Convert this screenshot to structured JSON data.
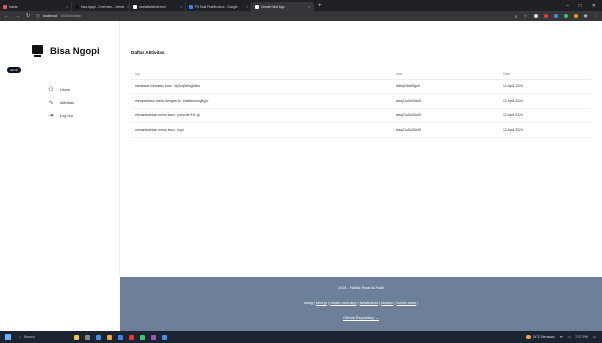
{
  "browser": {
    "tabs": [
      {
        "label": "Inside",
        "color": "#e85a4f",
        "active": false
      },
      {
        "label": "bisa-ngopi - Overview – Vercel",
        "color": "#111111",
        "active": false
      },
      {
        "label": "rizaladlafi/next-test",
        "color": "#ffffff",
        "active": false
      },
      {
        "label": "P3 Soal Praktik.docx - Google",
        "color": "#3b82f6",
        "active": false
      },
      {
        "label": "Create Next App",
        "color": "#ffffff",
        "active": true
      }
    ],
    "new_tab": "+",
    "url_host": "localhost",
    "url_path": ":3000/activity"
  },
  "sidebar": {
    "brand": "Bisa Ngopi",
    "role": "admin",
    "items": [
      {
        "label": "Users",
        "icon": "user-icon",
        "glyph": "⚇"
      },
      {
        "label": "Aktivitas",
        "icon": "activity-icon",
        "glyph": "∿"
      },
      {
        "label": "Log out",
        "icon": "logout-icon",
        "glyph": "⇥"
      }
    ]
  },
  "main": {
    "title": "Daftar Aktivitas",
    "columns": [
      "log",
      "user",
      "Date"
    ],
    "rows": [
      {
        "log": "membuat menuaku baru : idj3oq0eksg0abc",
        "user": "f6kbyf18a03go0",
        "date": "12 April 2024"
      },
      {
        "log": "memperbarui menu dengan id : tlrabbocmuyihjyv",
        "user": "tzeq21u5u00c05",
        "date": "12 April 2024"
      },
      {
        "log": "menambahkan menu baru : porsche 911 gt",
        "user": "tzeq21u5u00c05",
        "date": "12 April 2024"
      },
      {
        "log": "menambahkan menu baru : kopi",
        "user": "tzeq21u5u00c05",
        "date": "12 April 2024"
      }
    ]
  },
  "footer": {
    "credit": "2024 - Hafidz Rizal Al-Fadli",
    "using_prefix": "using |",
    "tech": [
      "next.js",
      "create-next-app",
      "tailwindcss",
      "shadcn",
      "lucide-react"
    ],
    "repo_link": "GitHub Repository →"
  },
  "taskbar": {
    "search": "Search",
    "weather": "24°C Berawan",
    "time": "7:17 PM"
  },
  "colors": {
    "footer_bg": "#6d7f99",
    "chrome_bg": "#1f2124",
    "taskbar_bg": "#1c2331"
  }
}
